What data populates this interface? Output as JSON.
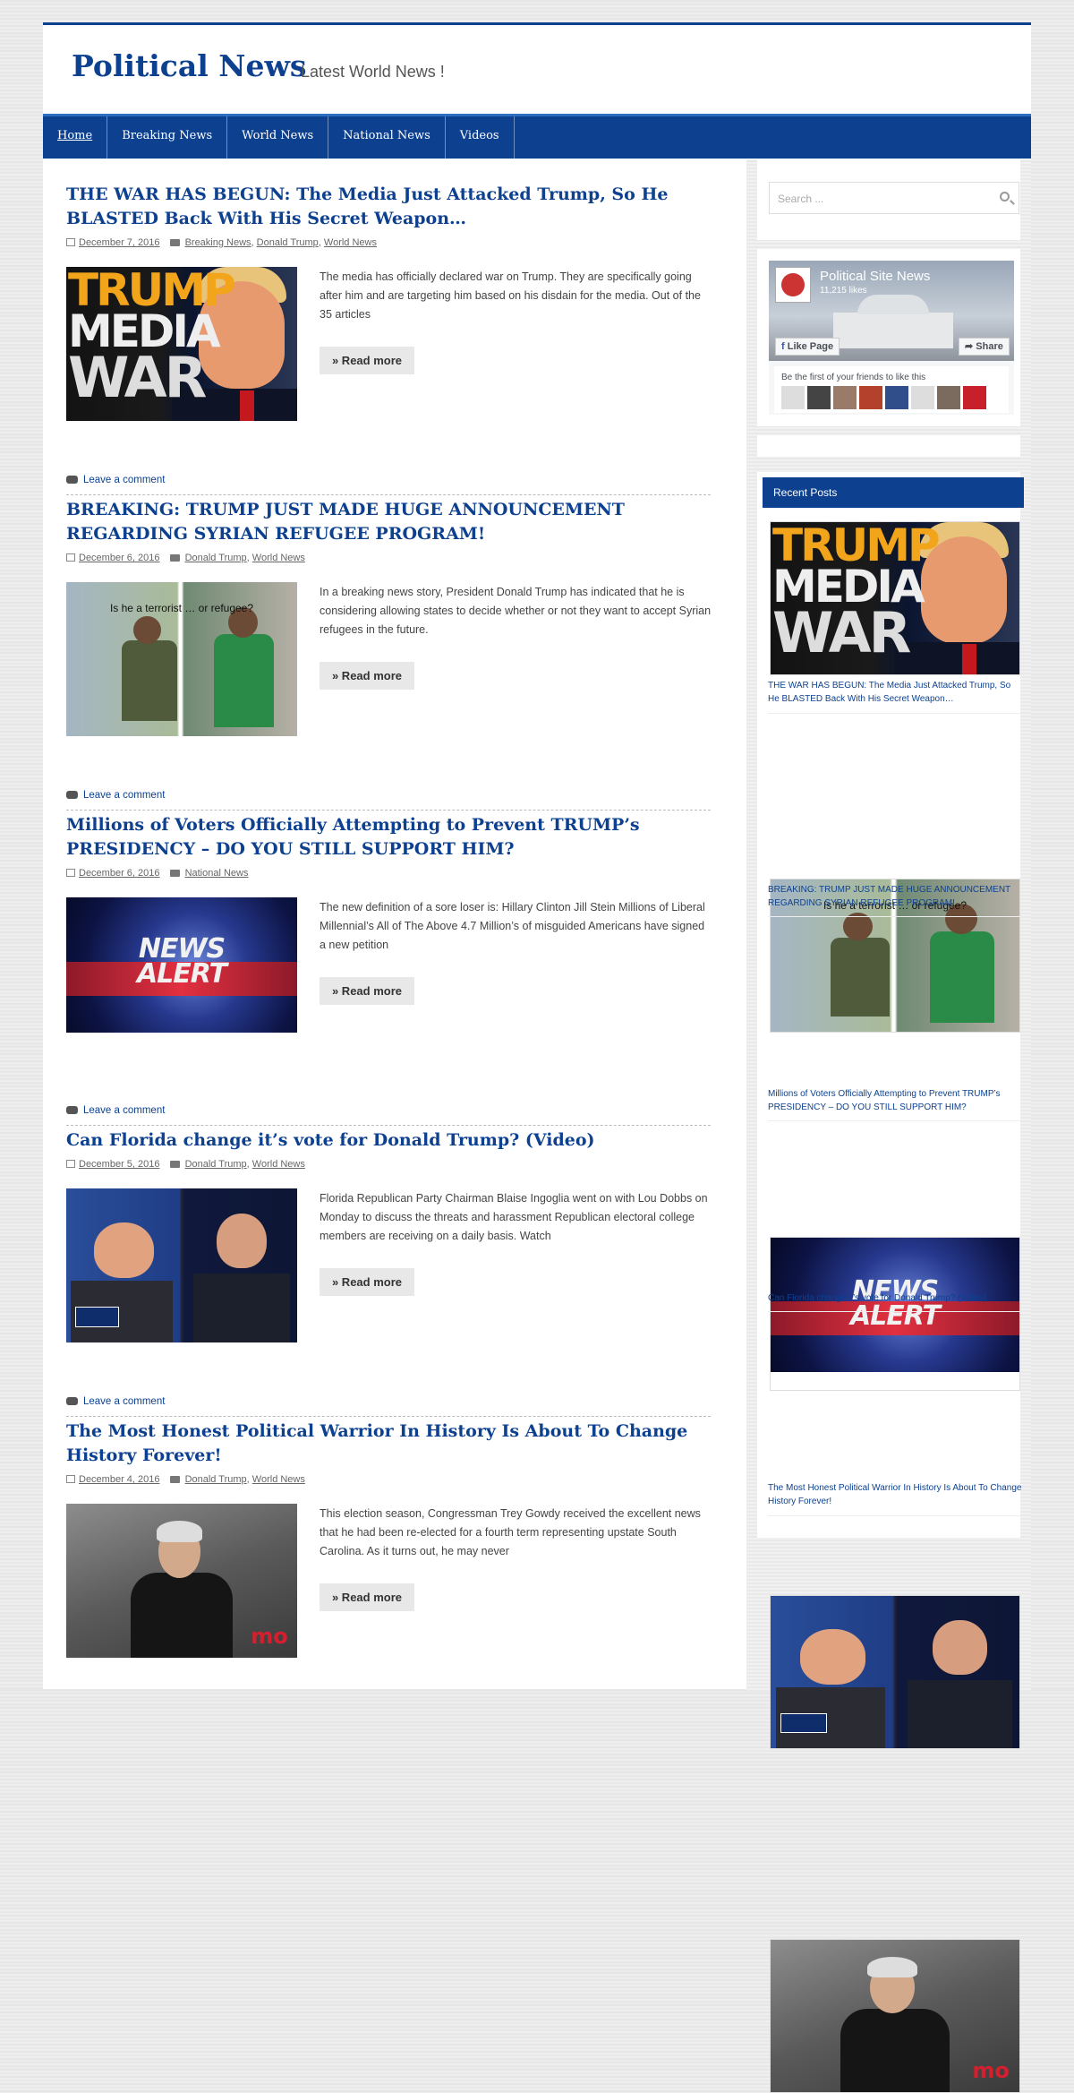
{
  "site": {
    "title": "Political News",
    "tagline": "Latest World News !"
  },
  "nav": [
    {
      "label": "Home"
    },
    {
      "label": "Breaking News"
    },
    {
      "label": "World News"
    },
    {
      "label": "National News"
    },
    {
      "label": "Videos"
    }
  ],
  "posts": [
    {
      "title": "THE WAR HAS BEGUN: The Media Just Attacked Trump, So He BLASTED Back With His Secret Weapon…",
      "date": "December 7, 2016",
      "categories": [
        "Breaking News",
        "Donald Trump",
        "World News"
      ],
      "excerpt": "The media has officially declared war on Trump. They are specifically going after him and are targeting him based on his disdain for the media. Out of the 35 articles",
      "read_more": "» Read more",
      "comment": "Leave a comment",
      "image_text": [
        "TRUMP",
        "MEDIA",
        "WAR"
      ]
    },
    {
      "title": "BREAKING: TRUMP JUST MADE HUGE ANNOUNCEMENT REGARDING SYRIAN REFUGEE PROGRAM!",
      "date": "December 6, 2016",
      "categories": [
        "Donald Trump",
        "World News"
      ],
      "excerpt": "In a breaking news story, President Donald Trump has indicated that he is considering allowing states to decide whether or not they want to accept Syrian refugees in the future.",
      "read_more": "» Read more",
      "comment": "Leave a comment",
      "image_text": [
        "Is he a terrorist … or refugee?"
      ]
    },
    {
      "title": "Millions of Voters Officially Attempting to Prevent TRUMP’s PRESIDENCY – DO YOU STILL SUPPORT HIM?",
      "date": "December 6, 2016",
      "categories": [
        "National News"
      ],
      "excerpt": "The new definition of a sore loser is: Hillary Clinton Jill Stein Millions of Liberal Millennial’s All of The Above 4.7 Million’s of misguided Americans have signed a new petition",
      "read_more": "» Read more",
      "comment": "Leave a comment",
      "image_text": [
        "NEWS",
        "ALERT"
      ]
    },
    {
      "title": "Can Florida change it’s vote for Donald Trump? (Video)",
      "date": "December 5, 2016",
      "categories": [
        "Donald Trump",
        "World News"
      ],
      "excerpt": "Florida Republican Party Chairman Blaise Ingoglia went on with Lou Dobbs on Monday to discuss the threats and harassment Republican electoral college members are receiving on a daily basis. Watch",
      "read_more": "» Read more",
      "comment": "Leave a comment",
      "image_text": []
    },
    {
      "title": "The Most Honest Political Warrior In History Is About To Change History Forever!",
      "date": "December 4, 2016",
      "categories": [
        "Donald Trump",
        "World News"
      ],
      "excerpt": "This election season, Congressman Trey Gowdy received the excellent news that he had been re-elected for a fourth term representing upstate South Carolina. As it turns out, he may never",
      "read_more": "» Read more",
      "comment": "Leave a comment",
      "image_text": [
        "mo"
      ]
    }
  ],
  "sidebar": {
    "search_placeholder": "Search ...",
    "facebook": {
      "page_name": "Political Site News",
      "likes": "11,215 likes",
      "like_button": "Like Page",
      "share_button": "Share",
      "friends_text": "Be the first of your friends to like this"
    },
    "recent_posts_title": "Recent Posts",
    "recent_posts": [
      "THE WAR HAS BEGUN: The Media Just Attacked Trump, So He BLASTED Back With His Secret Weapon…",
      "BREAKING: TRUMP JUST MADE HUGE ANNOUNCEMENT REGARDING SYRIAN REFUGEE PROGRAM!",
      "Millions of Voters Officially Attempting to Prevent TRUMP’s PRESIDENCY – DO YOU STILL SUPPORT HIM?",
      "Can Florida change it’s vote for Donald Trump? (Video)",
      "The Most Honest Political Warrior In History Is About To Change History Forever!"
    ]
  },
  "colors": {
    "brand": "#0d4190",
    "accent": "#2f6fc0"
  }
}
